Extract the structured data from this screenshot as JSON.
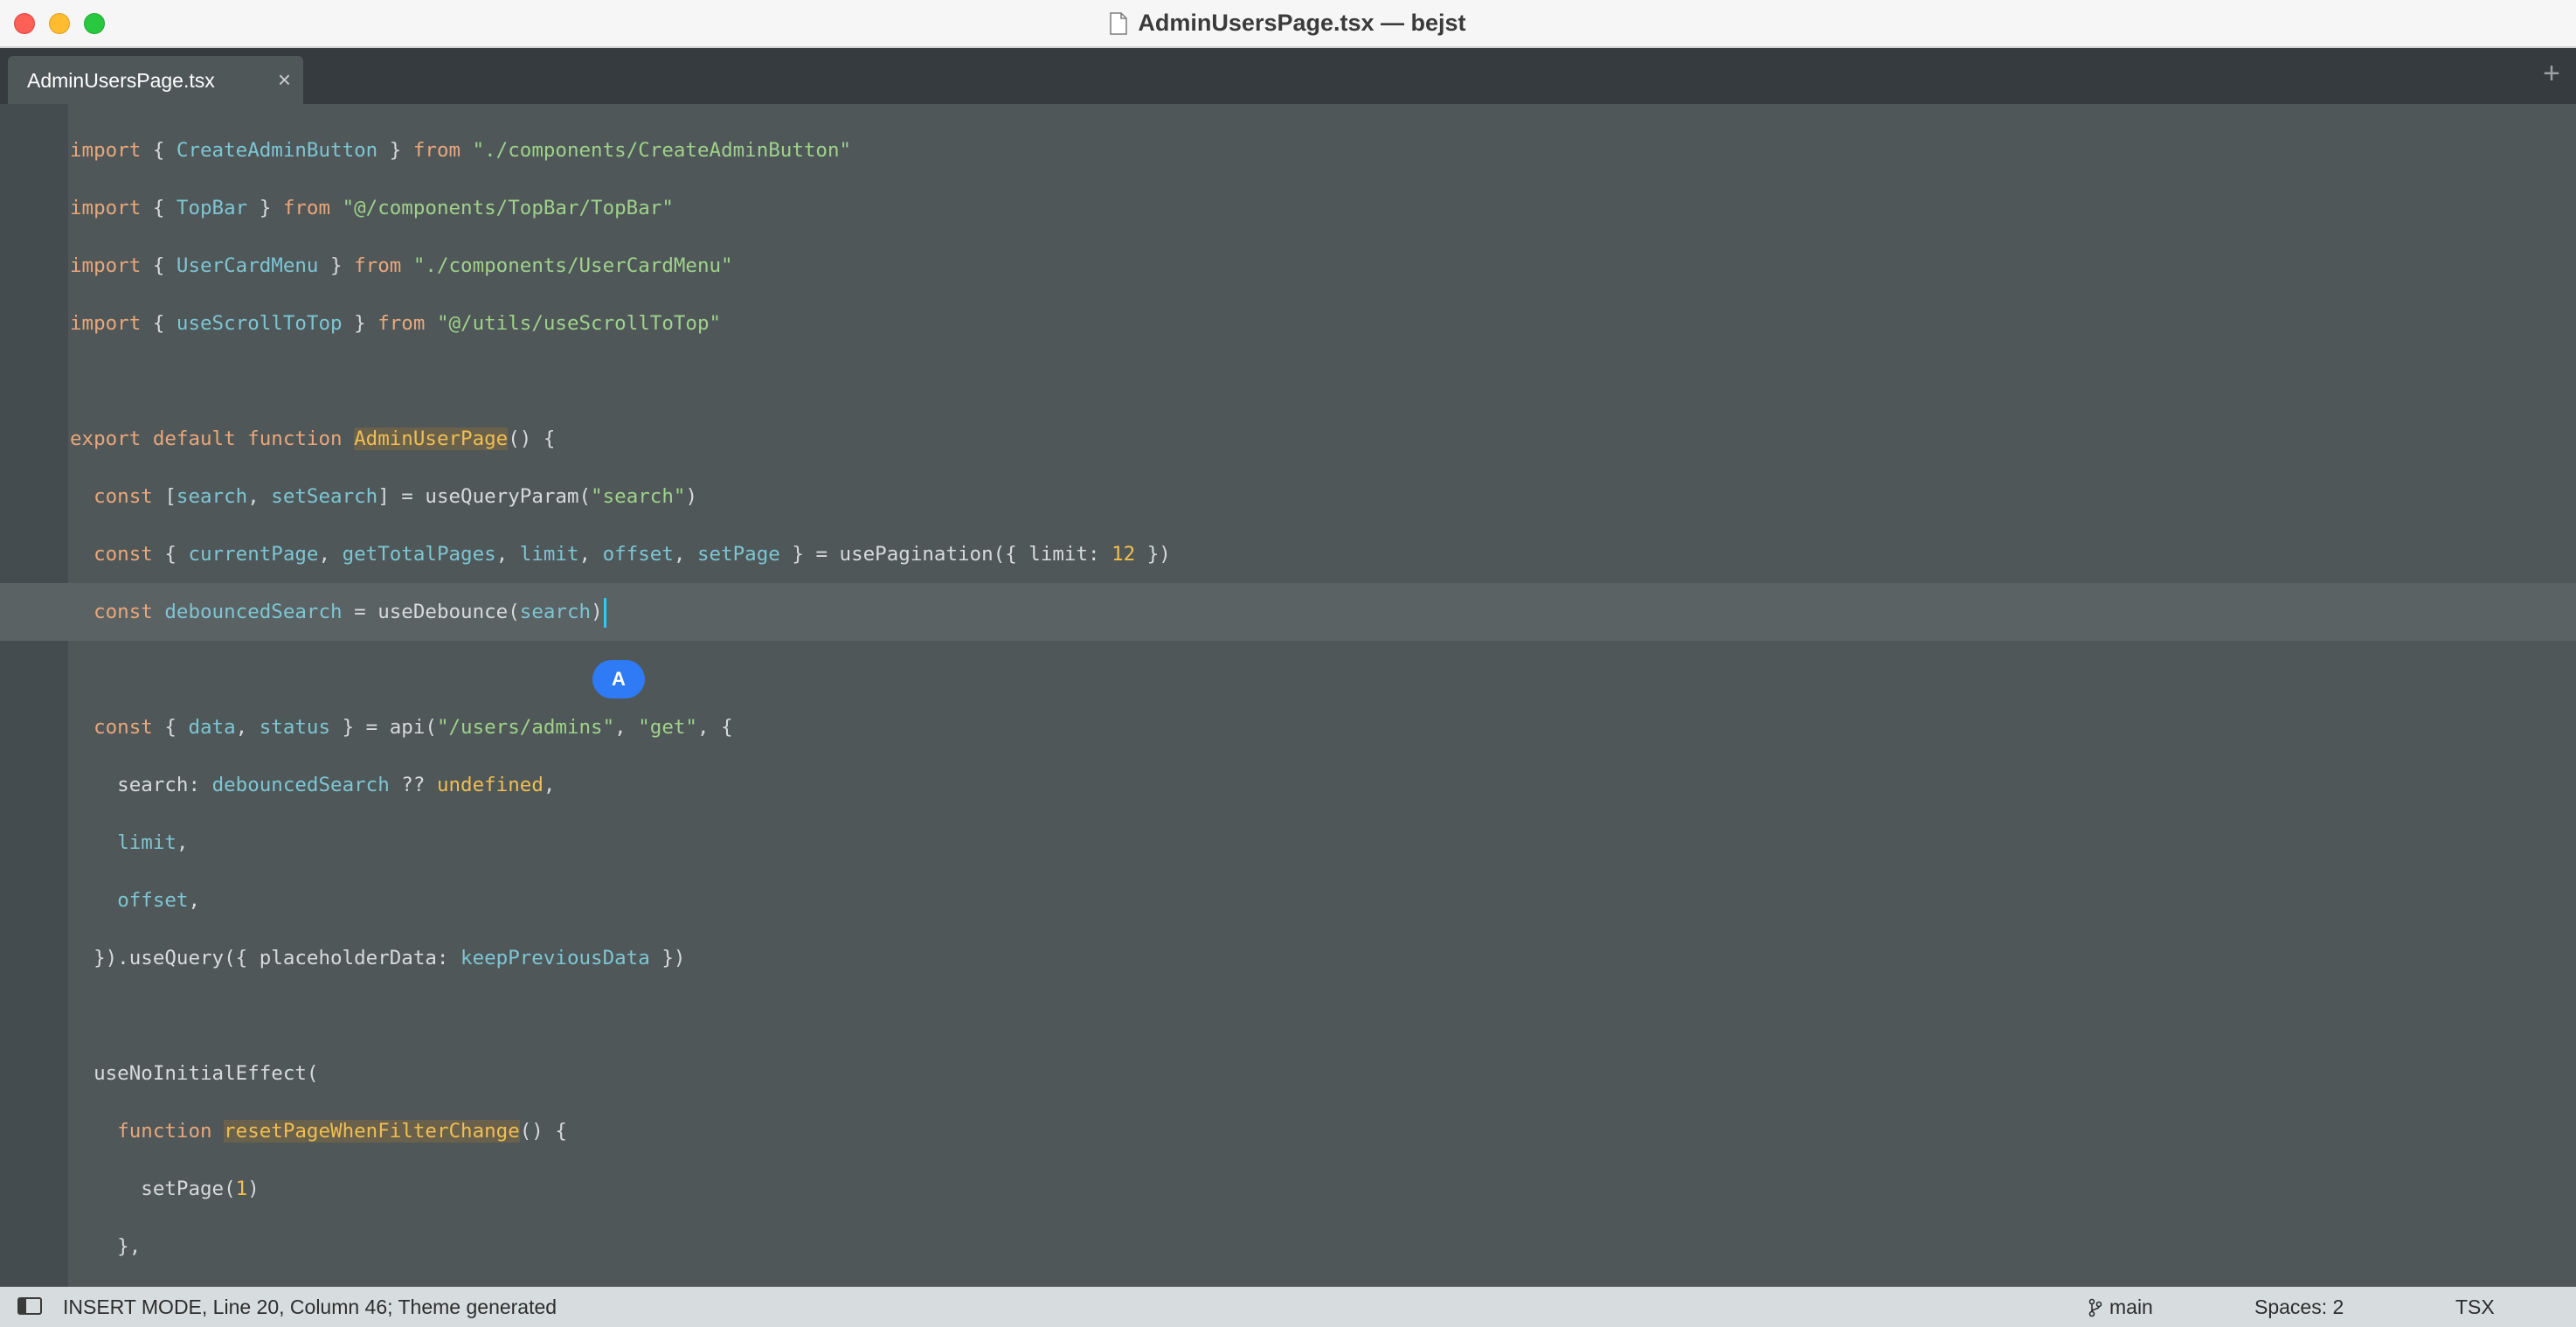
{
  "window": {
    "title": "AdminUsersPage.tsx — bejst"
  },
  "tabs": [
    {
      "label": "AdminUsersPage.tsx",
      "close": "×"
    }
  ],
  "tabbar": {
    "add": "+"
  },
  "editor": {
    "lines": [
      [
        [
          "kw",
          "import"
        ],
        [
          "plain",
          " { "
        ],
        [
          "id",
          "CreateAdminButton"
        ],
        [
          "plain",
          " } "
        ],
        [
          "kw",
          "from"
        ],
        [
          "plain",
          " "
        ],
        [
          "str",
          "\"./components/CreateAdminButton\""
        ]
      ],
      [
        [
          "kw",
          "import"
        ],
        [
          "plain",
          " { "
        ],
        [
          "id",
          "TopBar"
        ],
        [
          "plain",
          " } "
        ],
        [
          "kw",
          "from"
        ],
        [
          "plain",
          " "
        ],
        [
          "str",
          "\"@/components/TopBar/TopBar\""
        ]
      ],
      [
        [
          "kw",
          "import"
        ],
        [
          "plain",
          " { "
        ],
        [
          "id",
          "UserCardMenu"
        ],
        [
          "plain",
          " } "
        ],
        [
          "kw",
          "from"
        ],
        [
          "plain",
          " "
        ],
        [
          "str",
          "\"./components/UserCardMenu\""
        ]
      ],
      [
        [
          "kw",
          "import"
        ],
        [
          "plain",
          " { "
        ],
        [
          "id",
          "useScrollToTop"
        ],
        [
          "plain",
          " } "
        ],
        [
          "kw",
          "from"
        ],
        [
          "plain",
          " "
        ],
        [
          "str",
          "\"@/utils/useScrollToTop\""
        ]
      ],
      [],
      [
        [
          "kw",
          "export"
        ],
        [
          "plain",
          " "
        ],
        [
          "kw",
          "default"
        ],
        [
          "plain",
          " "
        ],
        [
          "kw",
          "function"
        ],
        [
          "plain",
          " "
        ],
        [
          "fn",
          "AdminUserPage"
        ],
        [
          "plain",
          "() {"
        ]
      ],
      [
        [
          "plain",
          "  "
        ],
        [
          "kw",
          "const"
        ],
        [
          "plain",
          " ["
        ],
        [
          "id",
          "search"
        ],
        [
          "plain",
          ", "
        ],
        [
          "id",
          "setSearch"
        ],
        [
          "plain",
          "] = useQueryParam("
        ],
        [
          "str",
          "\"search\""
        ],
        [
          "plain",
          ")"
        ]
      ],
      [
        [
          "plain",
          "  "
        ],
        [
          "kw",
          "const"
        ],
        [
          "plain",
          " { "
        ],
        [
          "id",
          "currentPage"
        ],
        [
          "plain",
          ", "
        ],
        [
          "id",
          "getTotalPages"
        ],
        [
          "plain",
          ", "
        ],
        [
          "id",
          "limit"
        ],
        [
          "plain",
          ", "
        ],
        [
          "id",
          "offset"
        ],
        [
          "plain",
          ", "
        ],
        [
          "id",
          "setPage"
        ],
        [
          "plain",
          " } = usePagination({ limit: "
        ],
        [
          "num",
          "12"
        ],
        [
          "plain",
          " })"
        ]
      ],
      [
        [
          "plain",
          "  "
        ],
        [
          "kw",
          "const"
        ],
        [
          "plain",
          " "
        ],
        [
          "id",
          "debouncedSearch"
        ],
        [
          "plain",
          " = useDebounce("
        ],
        [
          "id",
          "search"
        ],
        [
          "plain",
          ")"
        ]
      ],
      [],
      [
        [
          "plain",
          "  "
        ],
        [
          "kw",
          "const"
        ],
        [
          "plain",
          " { "
        ],
        [
          "id",
          "data"
        ],
        [
          "plain",
          ", "
        ],
        [
          "id",
          "status"
        ],
        [
          "plain",
          " } = api("
        ],
        [
          "str",
          "\"/users/admins\""
        ],
        [
          "plain",
          ", "
        ],
        [
          "str",
          "\"get\""
        ],
        [
          "plain",
          ", {"
        ]
      ],
      [
        [
          "plain",
          "    search: "
        ],
        [
          "id",
          "debouncedSearch"
        ],
        [
          "plain",
          " ?? "
        ],
        [
          "und",
          "undefined"
        ],
        [
          "plain",
          ","
        ]
      ],
      [
        [
          "plain",
          "    "
        ],
        [
          "id",
          "limit"
        ],
        [
          "plain",
          ","
        ]
      ],
      [
        [
          "plain",
          "    "
        ],
        [
          "id",
          "offset"
        ],
        [
          "plain",
          ","
        ]
      ],
      [
        [
          "plain",
          "  }).useQuery({ placeholderData: "
        ],
        [
          "id",
          "keepPreviousData"
        ],
        [
          "plain",
          " })"
        ]
      ],
      [],
      [
        [
          "plain",
          "  useNoInitialEffect("
        ]
      ],
      [
        [
          "plain",
          "    "
        ],
        [
          "kw",
          "function"
        ],
        [
          "plain",
          " "
        ],
        [
          "fn",
          "resetPageWhenFilterChange"
        ],
        [
          "plain",
          "() {"
        ]
      ],
      [
        [
          "plain",
          "      setPage("
        ],
        [
          "num",
          "1"
        ],
        [
          "plain",
          ")"
        ]
      ],
      [
        [
          "plain",
          "    },"
        ]
      ]
    ],
    "active_line_index": 8,
    "completion_badge": "A"
  },
  "statusbar": {
    "mode": "INSERT MODE, Line 20, Column 46; Theme generated",
    "branch": "main",
    "spaces": "Spaces: 2",
    "language": "TSX"
  },
  "colors": {
    "keyword": "#e9a77a",
    "identifier": "#7dc6d3",
    "string": "#9fd28a",
    "number": "#f2c04d",
    "background": "#4f5759"
  }
}
